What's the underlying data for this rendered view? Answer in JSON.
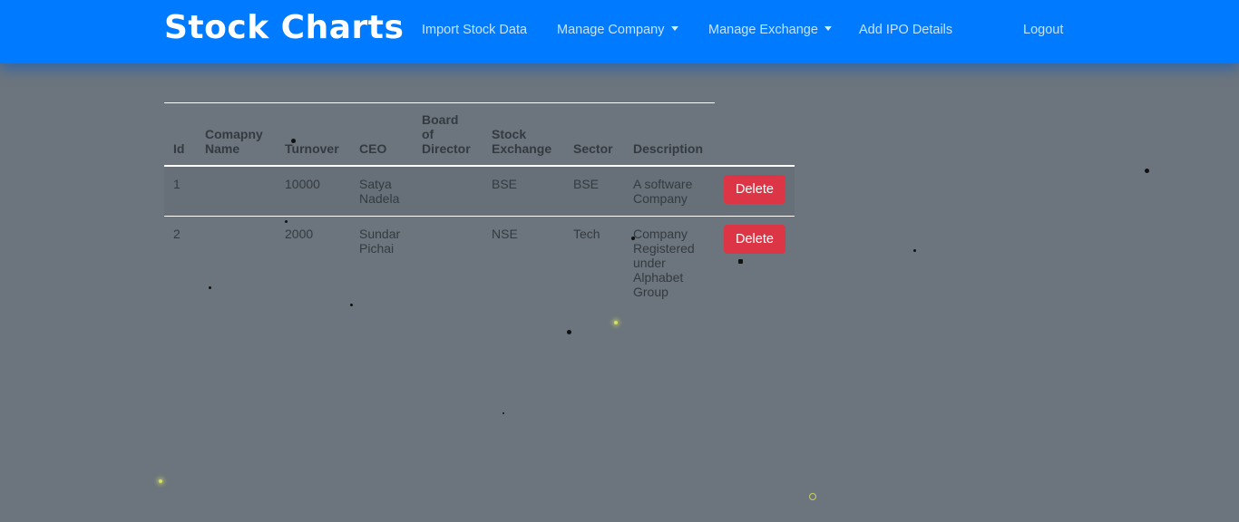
{
  "navbar": {
    "brand": "Stock Charts",
    "links": {
      "import": "Import Stock Data",
      "company": "Manage Company",
      "exchange": "Manage Exchange",
      "ipo": "Add IPO Details",
      "logout": "Logout"
    },
    "color": "#007bff"
  },
  "table": {
    "headers": {
      "id": "Id",
      "name": "Comapny Name",
      "turnover": "Turnover",
      "ceo": "CEO",
      "board": "Board of Director",
      "exchange": "Stock Exchange",
      "sector": "Sector",
      "description": "Description"
    },
    "rows": [
      {
        "id": "1",
        "name": "",
        "turnover": "10000",
        "ceo": "Satya Nadela",
        "board": "",
        "exchange": "BSE",
        "sector": "BSE",
        "description": "A software Company",
        "action": "Delete"
      },
      {
        "id": "2",
        "name": "",
        "turnover": "2000",
        "ceo": "Sundar Pichai",
        "board": "",
        "exchange": "NSE",
        "sector": "Tech",
        "description": "Company Registered under Alphabet Group",
        "action": "Delete"
      }
    ]
  },
  "colors": {
    "background": "#6c757d",
    "danger": "#dc3545"
  }
}
